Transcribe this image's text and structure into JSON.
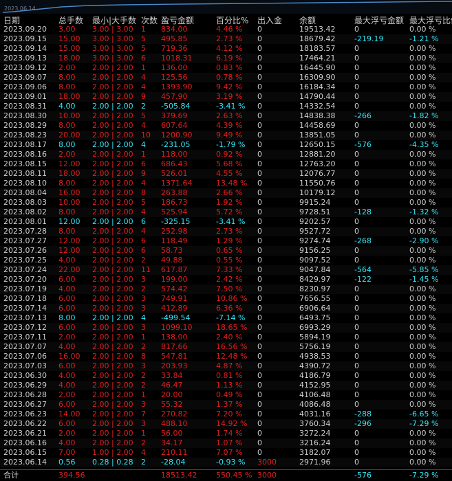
{
  "mini_chart": {
    "date_label": "2023.06.14",
    "line_color": "#4a88c8"
  },
  "colors": {
    "loss": "#35e4f4",
    "profit": "#e11f1f",
    "neutral": "#cfcfcf",
    "background": "#000000"
  },
  "headers": {
    "date": "日期",
    "total_lots": "总手数",
    "min_max_lots": "最小|大手数",
    "count": "次数",
    "pnl": "盈亏金额",
    "percent": "百分比%",
    "deposit": "出入金",
    "balance": "余额",
    "max_float_loss": "最大浮亏金额",
    "max_float_loss_pct": "最大浮亏比例"
  },
  "rows": [
    {
      "date": "2023.09.20",
      "lots": "3.00",
      "minmax": "3.00 | 3.00",
      "count": "1",
      "pnl": "834.00",
      "pct": "4.46 %",
      "deposit": "0",
      "balance": "19513.42",
      "max_float": "0",
      "max_float_pct": "0.00 %",
      "tone": "red"
    },
    {
      "date": "2023.09.15",
      "lots": "15.00",
      "minmax": "3.00 | 3.00",
      "count": "5",
      "pnl": "495.85",
      "pct": "2.73 %",
      "deposit": "0",
      "balance": "18679.42",
      "max_float": "-219.19",
      "max_float_pct": "-1.21 %",
      "tone": "red"
    },
    {
      "date": "2023.09.14",
      "lots": "15.00",
      "minmax": "3.00 | 3.00",
      "count": "5",
      "pnl": "719.36",
      "pct": "4.12 %",
      "deposit": "0",
      "balance": "18183.57",
      "max_float": "0",
      "max_float_pct": "0.00 %",
      "tone": "red"
    },
    {
      "date": "2023.09.13",
      "lots": "18.00",
      "minmax": "3.00 | 3.00",
      "count": "6",
      "pnl": "1018.31",
      "pct": "6.19 %",
      "deposit": "0",
      "balance": "17464.21",
      "max_float": "0",
      "max_float_pct": "0.00 %",
      "tone": "red"
    },
    {
      "date": "2023.09.12",
      "lots": "2.00",
      "minmax": "2.00 | 2.00",
      "count": "1",
      "pnl": "136.00",
      "pct": "0.83 %",
      "deposit": "0",
      "balance": "16445.90",
      "max_float": "0",
      "max_float_pct": "0.00 %",
      "tone": "red"
    },
    {
      "date": "2023.09.07",
      "lots": "8.00",
      "minmax": "2.00 | 2.00",
      "count": "4",
      "pnl": "125.56",
      "pct": "0.78 %",
      "deposit": "0",
      "balance": "16309.90",
      "max_float": "0",
      "max_float_pct": "0.00 %",
      "tone": "red"
    },
    {
      "date": "2023.09.06",
      "lots": "8.00",
      "minmax": "2.00 | 2.00",
      "count": "4",
      "pnl": "1393.90",
      "pct": "9.42 %",
      "deposit": "0",
      "balance": "16184.34",
      "max_float": "0",
      "max_float_pct": "0.00 %",
      "tone": "red"
    },
    {
      "date": "2023.09.01",
      "lots": "18.00",
      "minmax": "2.00 | 2.00",
      "count": "9",
      "pnl": "457.90",
      "pct": "3.19 %",
      "deposit": "0",
      "balance": "14790.44",
      "max_float": "0",
      "max_float_pct": "0.00 %",
      "tone": "red"
    },
    {
      "date": "2023.08.31",
      "lots": "4.00",
      "minmax": "2.00 | 2.00",
      "count": "2",
      "pnl": "-505.84",
      "pct": "-3.41 %",
      "deposit": "0",
      "balance": "14332.54",
      "max_float": "0",
      "max_float_pct": "0.00 %",
      "tone": "cyan"
    },
    {
      "date": "2023.08.30",
      "lots": "10.00",
      "minmax": "2.00 | 2.00",
      "count": "5",
      "pnl": "379.69",
      "pct": "2.63 %",
      "deposit": "0",
      "balance": "14838.38",
      "max_float": "-266",
      "max_float_pct": "-1.82 %",
      "tone": "red"
    },
    {
      "date": "2023.08.29",
      "lots": "8.00",
      "minmax": "2.00 | 2.00",
      "count": "4",
      "pnl": "607.64",
      "pct": "4.39 %",
      "deposit": "0",
      "balance": "14458.69",
      "max_float": "0",
      "max_float_pct": "0.00 %",
      "tone": "red"
    },
    {
      "date": "2023.08.23",
      "lots": "20.00",
      "minmax": "2.00 | 2.00",
      "count": "10",
      "pnl": "1200.90",
      "pct": "9.49 %",
      "deposit": "0",
      "balance": "13851.05",
      "max_float": "0",
      "max_float_pct": "0.00 %",
      "tone": "red"
    },
    {
      "date": "2023.08.17",
      "lots": "8.00",
      "minmax": "2.00 | 2.00",
      "count": "4",
      "pnl": "-231.05",
      "pct": "-1.79 %",
      "deposit": "0",
      "balance": "12650.15",
      "max_float": "-576",
      "max_float_pct": "-4.35 %",
      "tone": "cyan"
    },
    {
      "date": "2023.08.16",
      "lots": "2.00",
      "minmax": "2.00 | 2.00",
      "count": "1",
      "pnl": "118.00",
      "pct": "0.92 %",
      "deposit": "0",
      "balance": "12881.20",
      "max_float": "0",
      "max_float_pct": "0.00 %",
      "tone": "red"
    },
    {
      "date": "2023.08.15",
      "lots": "12.00",
      "minmax": "2.00 | 2.00",
      "count": "6",
      "pnl": "686.43",
      "pct": "5.68 %",
      "deposit": "0",
      "balance": "12763.20",
      "max_float": "0",
      "max_float_pct": "0.00 %",
      "tone": "red"
    },
    {
      "date": "2023.08.11",
      "lots": "18.00",
      "minmax": "2.00 | 2.00",
      "count": "9",
      "pnl": "526.01",
      "pct": "4.55 %",
      "deposit": "0",
      "balance": "12076.77",
      "max_float": "0",
      "max_float_pct": "0.00 %",
      "tone": "red"
    },
    {
      "date": "2023.08.10",
      "lots": "8.00",
      "minmax": "2.00 | 2.00",
      "count": "4",
      "pnl": "1371.64",
      "pct": "13.48 %",
      "deposit": "0",
      "balance": "11550.76",
      "max_float": "0",
      "max_float_pct": "0.00 %",
      "tone": "red"
    },
    {
      "date": "2023.08.04",
      "lots": "16.00",
      "minmax": "2.00 | 2.00",
      "count": "8",
      "pnl": "263.88",
      "pct": "2.66 %",
      "deposit": "0",
      "balance": "10179.12",
      "max_float": "0",
      "max_float_pct": "0.00 %",
      "tone": "red"
    },
    {
      "date": "2023.08.03",
      "lots": "10.00",
      "minmax": "2.00 | 2.00",
      "count": "5",
      "pnl": "186.73",
      "pct": "1.92 %",
      "deposit": "0",
      "balance": "9915.24",
      "max_float": "0",
      "max_float_pct": "0.00 %",
      "tone": "red"
    },
    {
      "date": "2023.08.02",
      "lots": "8.00",
      "minmax": "2.00 | 2.00",
      "count": "4",
      "pnl": "525.94",
      "pct": "5.72 %",
      "deposit": "0",
      "balance": "9728.51",
      "max_float": "-128",
      "max_float_pct": "-1.32 %",
      "tone": "red"
    },
    {
      "date": "2023.08.01",
      "lots": "12.00",
      "minmax": "2.00 | 2.00",
      "count": "6",
      "pnl": "-325.15",
      "pct": "-3.41 %",
      "deposit": "0",
      "balance": "9202.57",
      "max_float": "0",
      "max_float_pct": "0.00 %",
      "tone": "cyan"
    },
    {
      "date": "2023.07.28",
      "lots": "8.00",
      "minmax": "2.00 | 2.00",
      "count": "4",
      "pnl": "252.98",
      "pct": "2.73 %",
      "deposit": "0",
      "balance": "9527.72",
      "max_float": "0",
      "max_float_pct": "0.00 %",
      "tone": "red"
    },
    {
      "date": "2023.07.27",
      "lots": "12.00",
      "minmax": "2.00 | 2.00",
      "count": "6",
      "pnl": "118.49",
      "pct": "1.29 %",
      "deposit": "0",
      "balance": "9274.74",
      "max_float": "-268",
      "max_float_pct": "-2.90 %",
      "tone": "red"
    },
    {
      "date": "2023.07.26",
      "lots": "12.00",
      "minmax": "2.00 | 2.00",
      "count": "6",
      "pnl": "58.73",
      "pct": "0.65 %",
      "deposit": "0",
      "balance": "9156.25",
      "max_float": "0",
      "max_float_pct": "0.00 %",
      "tone": "red"
    },
    {
      "date": "2023.07.25",
      "lots": "4.00",
      "minmax": "2.00 | 2.00",
      "count": "2",
      "pnl": "49.88",
      "pct": "0.55 %",
      "deposit": "0",
      "balance": "9097.52",
      "max_float": "0",
      "max_float_pct": "0.00 %",
      "tone": "red"
    },
    {
      "date": "2023.07.24",
      "lots": "22.00",
      "minmax": "2.00 | 2.00",
      "count": "11",
      "pnl": "617.87",
      "pct": "7.33 %",
      "deposit": "0",
      "balance": "9047.84",
      "max_float": "-564",
      "max_float_pct": "-5.85 %",
      "tone": "red"
    },
    {
      "date": "2023.07.20",
      "lots": "6.00",
      "minmax": "2.00 | 2.00",
      "count": "3",
      "pnl": "199.00",
      "pct": "2.42 %",
      "deposit": "0",
      "balance": "8429.97",
      "max_float": "-122",
      "max_float_pct": "-1.45 %",
      "tone": "red"
    },
    {
      "date": "2023.07.19",
      "lots": "4.00",
      "minmax": "2.00 | 2.00",
      "count": "2",
      "pnl": "574.42",
      "pct": "7.50 %",
      "deposit": "0",
      "balance": "8230.97",
      "max_float": "0",
      "max_float_pct": "0.00 %",
      "tone": "red"
    },
    {
      "date": "2023.07.18",
      "lots": "6.00",
      "minmax": "2.00 | 2.00",
      "count": "3",
      "pnl": "749.91",
      "pct": "10.86 %",
      "deposit": "0",
      "balance": "7656.55",
      "max_float": "0",
      "max_float_pct": "0.00 %",
      "tone": "red"
    },
    {
      "date": "2023.07.14",
      "lots": "6.00",
      "minmax": "2.00 | 2.00",
      "count": "3",
      "pnl": "412.89",
      "pct": "6.36 %",
      "deposit": "0",
      "balance": "6906.64",
      "max_float": "0",
      "max_float_pct": "0.00 %",
      "tone": "red"
    },
    {
      "date": "2023.07.13",
      "lots": "8.00",
      "minmax": "2.00 | 2.00",
      "count": "4",
      "pnl": "-499.54",
      "pct": "-7.14 %",
      "deposit": "0",
      "balance": "6493.75",
      "max_float": "0",
      "max_float_pct": "0.00 %",
      "tone": "cyan"
    },
    {
      "date": "2023.07.12",
      "lots": "6.00",
      "minmax": "2.00 | 2.00",
      "count": "3",
      "pnl": "1099.10",
      "pct": "18.65 %",
      "deposit": "0",
      "balance": "6993.29",
      "max_float": "0",
      "max_float_pct": "0.00 %",
      "tone": "red"
    },
    {
      "date": "2023.07.11",
      "lots": "2.00",
      "minmax": "2.00 | 2.00",
      "count": "1",
      "pnl": "138.00",
      "pct": "2.40 %",
      "deposit": "0",
      "balance": "5894.19",
      "max_float": "0",
      "max_float_pct": "0.00 %",
      "tone": "red"
    },
    {
      "date": "2023.07.07",
      "lots": "4.00",
      "minmax": "2.00 | 2.00",
      "count": "2",
      "pnl": "817.66",
      "pct": "16.56 %",
      "deposit": "0",
      "balance": "5756.19",
      "max_float": "0",
      "max_float_pct": "0.00 %",
      "tone": "red"
    },
    {
      "date": "2023.07.06",
      "lots": "16.00",
      "minmax": "2.00 | 2.00",
      "count": "8",
      "pnl": "547.81",
      "pct": "12.48 %",
      "deposit": "0",
      "balance": "4938.53",
      "max_float": "0",
      "max_float_pct": "0.00 %",
      "tone": "red"
    },
    {
      "date": "2023.07.03",
      "lots": "6.00",
      "minmax": "2.00 | 2.00",
      "count": "3",
      "pnl": "203.93",
      "pct": "4.87 %",
      "deposit": "0",
      "balance": "4390.72",
      "max_float": "0",
      "max_float_pct": "0.00 %",
      "tone": "red"
    },
    {
      "date": "2023.06.30",
      "lots": "4.00",
      "minmax": "2.00 | 2.00",
      "count": "2",
      "pnl": "33.84",
      "pct": "0.81 %",
      "deposit": "0",
      "balance": "4186.79",
      "max_float": "0",
      "max_float_pct": "0.00 %",
      "tone": "red"
    },
    {
      "date": "2023.06.29",
      "lots": "4.00",
      "minmax": "2.00 | 2.00",
      "count": "2",
      "pnl": "46.47",
      "pct": "1.13 %",
      "deposit": "0",
      "balance": "4152.95",
      "max_float": "0",
      "max_float_pct": "0.00 %",
      "tone": "red"
    },
    {
      "date": "2023.06.28",
      "lots": "2.00",
      "minmax": "2.00 | 2.00",
      "count": "1",
      "pnl": "20.00",
      "pct": "0.49 %",
      "deposit": "0",
      "balance": "4106.48",
      "max_float": "0",
      "max_float_pct": "0.00 %",
      "tone": "red"
    },
    {
      "date": "2023.06.27",
      "lots": "6.00",
      "minmax": "2.00 | 2.00",
      "count": "3",
      "pnl": "55.32",
      "pct": "1.37 %",
      "deposit": "0",
      "balance": "4086.48",
      "max_float": "0",
      "max_float_pct": "0.00 %",
      "tone": "red"
    },
    {
      "date": "2023.06.23",
      "lots": "14.00",
      "minmax": "2.00 | 2.00",
      "count": "7",
      "pnl": "270.82",
      "pct": "7.20 %",
      "deposit": "0",
      "balance": "4031.16",
      "max_float": "-288",
      "max_float_pct": "-6.65 %",
      "tone": "red"
    },
    {
      "date": "2023.06.22",
      "lots": "6.00",
      "minmax": "2.00 | 2.00",
      "count": "3",
      "pnl": "488.10",
      "pct": "14.92 %",
      "deposit": "0",
      "balance": "3760.34",
      "max_float": "-296",
      "max_float_pct": "-7.29 %",
      "tone": "red"
    },
    {
      "date": "2023.06.21",
      "lots": "2.00",
      "minmax": "2.00 | 2.00",
      "count": "1",
      "pnl": "56.00",
      "pct": "1.74 %",
      "deposit": "0",
      "balance": "3272.24",
      "max_float": "0",
      "max_float_pct": "0.00 %",
      "tone": "red"
    },
    {
      "date": "2023.06.16",
      "lots": "4.00",
      "minmax": "2.00 | 2.00",
      "count": "2",
      "pnl": "34.17",
      "pct": "1.07 %",
      "deposit": "0",
      "balance": "3216.24",
      "max_float": "0",
      "max_float_pct": "0.00 %",
      "tone": "red"
    },
    {
      "date": "2023.06.15",
      "lots": "7.00",
      "minmax": "1.00 | 2.00",
      "count": "4",
      "pnl": "210.11",
      "pct": "7.07 %",
      "deposit": "0",
      "balance": "3182.07",
      "max_float": "0",
      "max_float_pct": "0.00 %",
      "tone": "red"
    },
    {
      "date": "2023.06.14",
      "lots": "0.56",
      "minmax": "0.28 | 0.28",
      "count": "2",
      "pnl": "-28.04",
      "pct": "-0.93 %",
      "deposit": "3000",
      "balance": "2971.96",
      "max_float": "0",
      "max_float_pct": "0.00 %",
      "tone": "cyan"
    }
  ],
  "total": {
    "label": "合计",
    "lots": "394.56",
    "pnl": "18513.42",
    "pct": "550.45 %",
    "deposit": "3000",
    "max_float": "-576",
    "max_float_pct": "-7.29 %"
  }
}
